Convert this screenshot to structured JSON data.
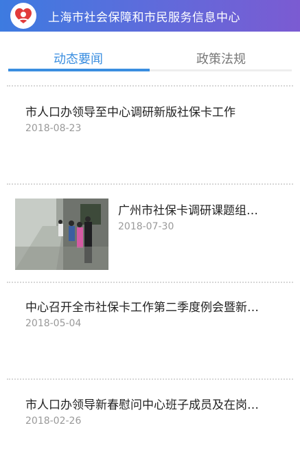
{
  "header": {
    "title": "上海市社会保障和市民服务信息中心",
    "gradient_start": "#3d7be0",
    "gradient_end": "#7b5bd2"
  },
  "tabs": [
    {
      "label": "动态要闻",
      "active": true
    },
    {
      "label": "政策法规",
      "active": false
    }
  ],
  "accent_color": "#3a8ee0",
  "news": [
    {
      "title": "市人口办领导至中心调研新版社保卡工作",
      "date": "2018-08-23",
      "has_image": false
    },
    {
      "title": "广州市社保卡调研课题组…",
      "date": "2018-07-30",
      "has_image": true,
      "image_icon": "photo-visitors-in-corridor"
    },
    {
      "title": "中心召开全市社保卡工作第二季度例会暨新…",
      "date": "2018-05-04",
      "has_image": false
    },
    {
      "title": "市人口办领导新春慰问中心班子成员及在岗…",
      "date": "2018-02-26",
      "has_image": false
    }
  ]
}
